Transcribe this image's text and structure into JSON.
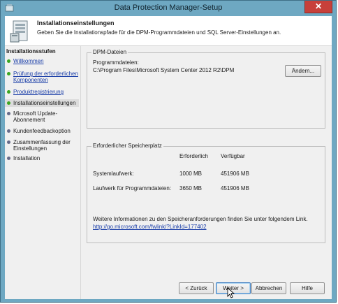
{
  "window": {
    "title": "Data Protection Manager-Setup",
    "close_glyph": "✕"
  },
  "header": {
    "title": "Installationseinstellungen",
    "subtitle": "Geben Sie die Installationspfade für die DPM-Programmdateien und SQL Server-Einstellungen an."
  },
  "nav": {
    "heading": "Installationsstufen",
    "items": [
      {
        "label": "Willkommen",
        "status": "done"
      },
      {
        "label": "Prüfung der erforderlichen Komponenten",
        "status": "done"
      },
      {
        "label": "Produktregistrierung",
        "status": "done"
      },
      {
        "label": "Installationseinstellungen",
        "status": "current"
      },
      {
        "label": "Microsoft Update-Abonnement",
        "status": "pending"
      },
      {
        "label": "Kundenfeedbackoption",
        "status": "pending"
      },
      {
        "label": "Zusammenfassung der Einstellungen",
        "status": "pending"
      },
      {
        "label": "Installation",
        "status": "pending"
      }
    ]
  },
  "dpm_files": {
    "group_title": "DPM-Dateien",
    "program_files_label": "Programmdateien:",
    "program_files_path": "C:\\Program Files\\Microsoft System Center 2012 R2\\DPM",
    "change_button": "Ändern..."
  },
  "storage": {
    "group_title": "Erforderlicher Speicherplatz",
    "col_required": "Erforderlich",
    "col_available": "Verfügbar",
    "rows": [
      {
        "label": "Systemlaufwerk:",
        "required": "1000 MB",
        "available": "451906 MB"
      },
      {
        "label": "Laufwerk für Programmdateien:",
        "required": "3650 MB",
        "available": "451906 MB"
      }
    ],
    "info_text": "Weitere Informationen zu den Speicheranforderungen finden Sie unter folgendem Link.",
    "info_link": "http://go.microsoft.com/fwlink/?LinkId=177402"
  },
  "buttons": {
    "back": "< Zurück",
    "next": "Weiter >",
    "cancel": "Abbrechen",
    "help": "Hilfe"
  },
  "colors": {
    "window_frame": "#6ea8c2",
    "close_red": "#c7403a",
    "done_dot": "#3aa61f",
    "pending_dot": "#666a88",
    "link": "#1a3ea8"
  }
}
